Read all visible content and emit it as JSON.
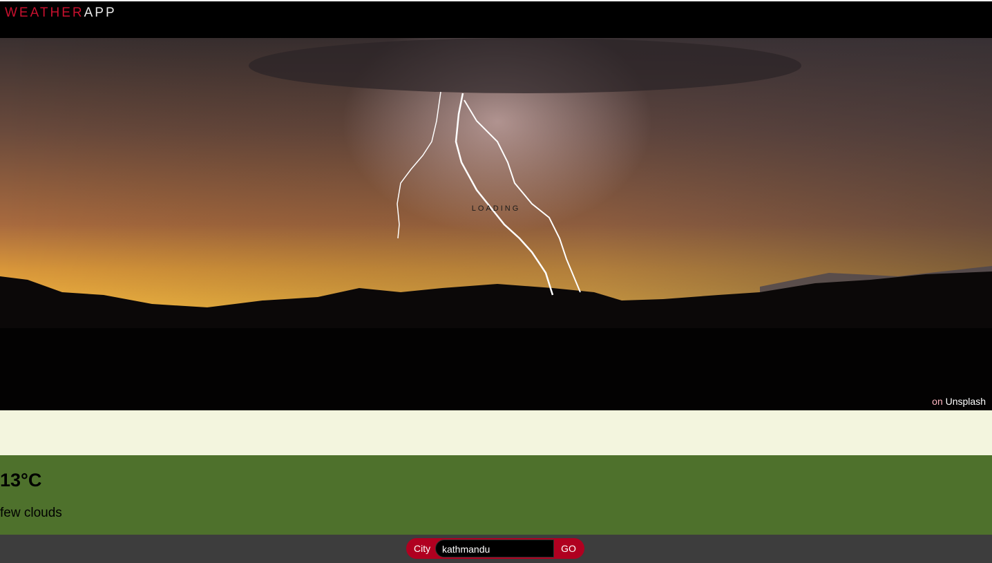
{
  "header": {
    "logo_part1": "WEATHER",
    "logo_part2": "APP"
  },
  "hero": {
    "status_text": "LOADING",
    "credit_on": "on",
    "credit_source": "Unsplash",
    "photo_subject": "lightning-storm-at-sunset-photo"
  },
  "weather": {
    "temperature": "13°C",
    "description": "few clouds"
  },
  "search": {
    "label": "City",
    "value": "kathmandu",
    "submit_label": "GO"
  },
  "colors": {
    "brand_red": "#c8102e",
    "search_red": "#b00020",
    "cream_band": "#f3f5de",
    "info_green": "#4e712c",
    "footer_gray": "#3d3d3d"
  }
}
